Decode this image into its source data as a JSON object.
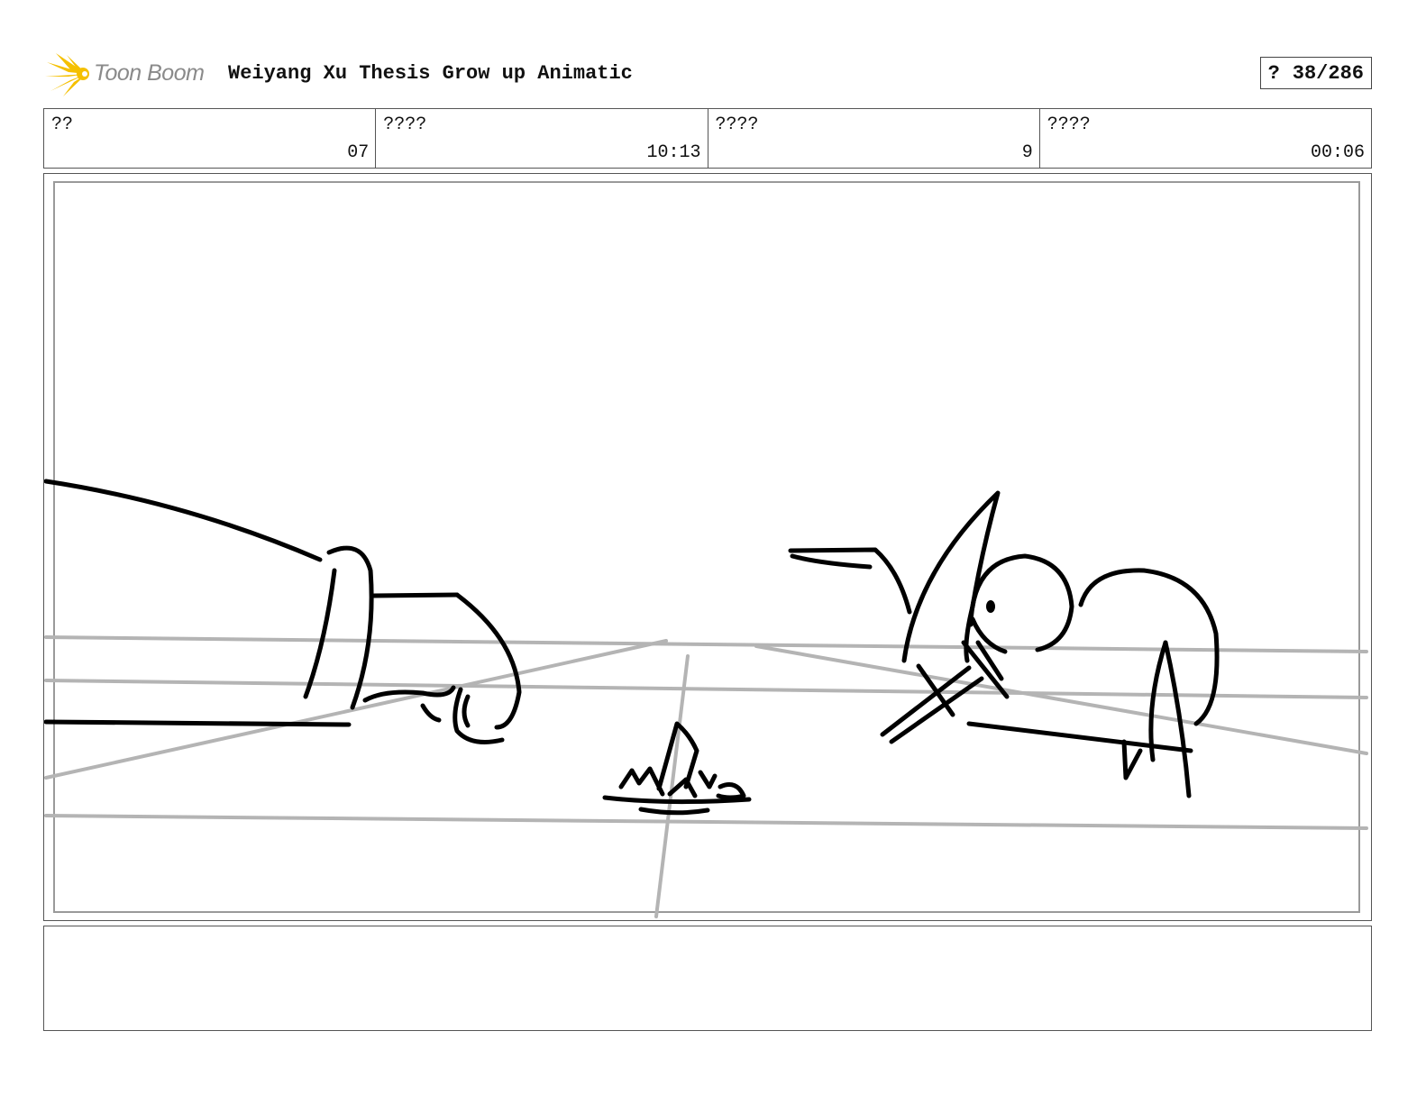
{
  "header": {
    "logo_text": "Toon Boom",
    "project_title": "Weiyang Xu Thesis Grow up Animatic",
    "page_label": "?",
    "page_number": "38/286"
  },
  "info_cells": [
    {
      "label": "??",
      "value": "07"
    },
    {
      "label": "????",
      "value": "10:13"
    },
    {
      "label": "????",
      "value": "9"
    },
    {
      "label": "????",
      "value": "00:06"
    }
  ],
  "panel": {
    "icon": "sketch-drawing",
    "colors": {
      "ink": "#000000",
      "guide": "#b4b4b4",
      "logo": "#f5c000"
    }
  },
  "notes": {
    "text": ""
  }
}
